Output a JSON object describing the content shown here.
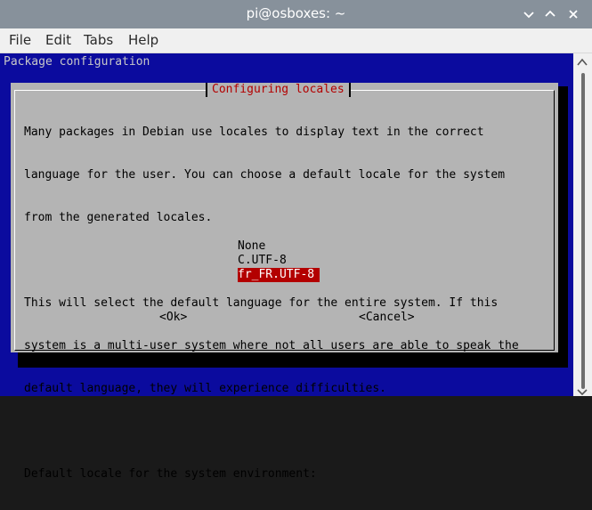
{
  "window": {
    "title": "pi@osboxes: ~"
  },
  "menu": {
    "items": [
      "File",
      "Edit",
      "Tabs",
      "Help"
    ]
  },
  "terminal": {
    "header": "Package configuration"
  },
  "dialog": {
    "title": "Configuring locales",
    "text_lines": [
      "Many packages in Debian use locales to display text in the correct",
      "language for the user. You can choose a default locale for the system",
      "from the generated locales.",
      "",
      "This will select the default language for the entire system. If this",
      "system is a multi-user system where not all users are able to speak the",
      "default language, they will experience difficulties.",
      "",
      "Default locale for the system environment:"
    ],
    "options": [
      "None",
      "C.UTF-8",
      "fr_FR.UTF-8"
    ],
    "selected_option": "fr_FR.UTF-8",
    "ok_label": "<Ok>",
    "cancel_label": "<Cancel>"
  },
  "colors": {
    "terminal_bg": "#0b0b9e",
    "dialog_bg": "#b4b4b4",
    "accent_red": "#b30000",
    "titlebar_bg": "#87919b"
  }
}
